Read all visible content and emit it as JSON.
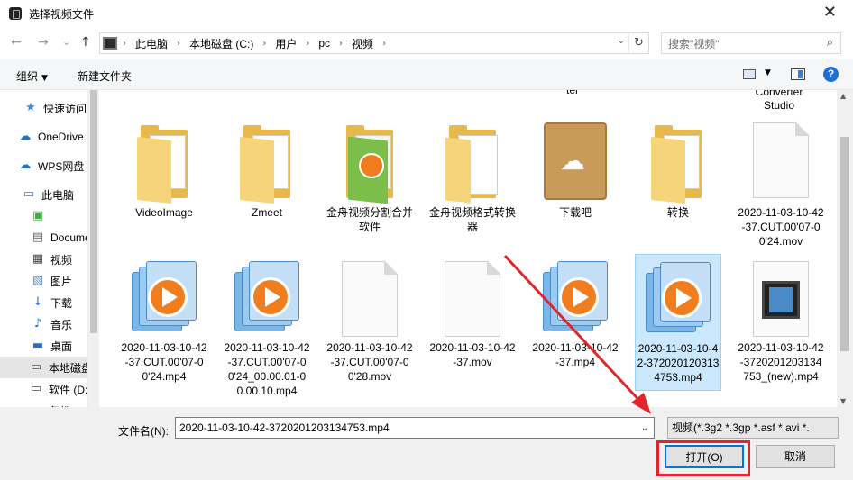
{
  "window": {
    "title": "选择视频文件",
    "close_glyph": "✕"
  },
  "nav": {
    "back_glyph": "←",
    "forward_glyph": "→",
    "recent_glyph": "⌄",
    "up_glyph": "↑",
    "breadcrumb": [
      "此电脑",
      "本地磁盘 (C:)",
      "用户",
      "pc",
      "视频"
    ],
    "breadcrumb_sep": "›",
    "dropdown_glyph": "⌄",
    "refresh_glyph": "↻",
    "search_placeholder": "搜索\"视频\"",
    "search_glyph": "⌕"
  },
  "toolbar": {
    "organize_label": "组织",
    "organize_caret": "▼",
    "new_folder_label": "新建文件夹",
    "view_caret": "▼",
    "help_label": "?"
  },
  "sidebar": {
    "items": [
      {
        "label": "快速访问",
        "icon": "star-icon",
        "glyph": "★",
        "color": "#3c88d8"
      },
      {
        "label": "OneDrive",
        "icon": "cloud-icon",
        "glyph": "☁",
        "color": "#1e73c8"
      },
      {
        "label": "WPS网盘",
        "icon": "cloud-icon",
        "glyph": "☁",
        "color": "#1e73c8"
      },
      {
        "label": "此电脑",
        "icon": "computer-icon",
        "glyph": "▭",
        "color": "#3a7bd5"
      },
      {
        "label": "",
        "icon": "app-icon",
        "glyph": "▣",
        "color": "#3eb03e"
      },
      {
        "label": "Documents",
        "icon": "document-icon",
        "glyph": "▤",
        "color": "#666666"
      },
      {
        "label": "视频",
        "icon": "film-icon",
        "glyph": "▦",
        "color": "#444444"
      },
      {
        "label": "图片",
        "icon": "picture-icon",
        "glyph": "▧",
        "color": "#5b86c6"
      },
      {
        "label": "下载",
        "icon": "download-icon",
        "glyph": "↓",
        "color": "#1e6fd9"
      },
      {
        "label": "音乐",
        "icon": "music-icon",
        "glyph": "♪",
        "color": "#1e6fd9"
      },
      {
        "label": "桌面",
        "icon": "desktop-icon",
        "glyph": "▬",
        "color": "#1e6fd9"
      },
      {
        "label": "本地磁盘 (C:)",
        "icon": "drive-icon",
        "glyph": "▭",
        "color": "#555555",
        "selected": true
      },
      {
        "label": "软件 (D:)",
        "icon": "drive-icon",
        "glyph": "▭",
        "color": "#555555"
      },
      {
        "label": "备份",
        "icon": "drive-icon",
        "glyph": "▭",
        "color": "#555555"
      }
    ]
  },
  "content": {
    "top_fragments": [
      "ter",
      "Converter",
      "Studio"
    ],
    "row1": [
      {
        "label": "VideoImage",
        "kind": "folder"
      },
      {
        "label": "Zmeet",
        "kind": "folder"
      },
      {
        "label": "金舟视频分割合并软件",
        "kind": "folder-media"
      },
      {
        "label": "金舟视频格式转换器",
        "kind": "folder-white"
      },
      {
        "label": "下载吧",
        "kind": "baidu"
      },
      {
        "label": "转换",
        "kind": "folder-plain"
      },
      {
        "label": "2020-11-03-10-42-37.CUT.00'07-00'24.mov",
        "kind": "doc"
      }
    ],
    "row2": [
      {
        "label": "2020-11-03-10-42-37.CUT.00'07-00'24.mp4",
        "kind": "wmp"
      },
      {
        "label": "2020-11-03-10-42-37.CUT.00'07-00'24_00.00.01-00.00.10.mp4",
        "kind": "wmp"
      },
      {
        "label": "2020-11-03-10-42-37.CUT.00'07-00'28.mov",
        "kind": "doc"
      },
      {
        "label": "2020-11-03-10-42-37.mov",
        "kind": "doc"
      },
      {
        "label": "2020-11-03-10-42-37.mp4",
        "kind": "wmp"
      },
      {
        "label": "2020-11-03-10-42-3720201203134753.mp4",
        "kind": "wmp",
        "selected": true
      },
      {
        "label": "2020-11-03-10-42-3720201203134753_(new).mp4",
        "kind": "vfile"
      }
    ]
  },
  "bottom": {
    "filename_label": "文件名(N):",
    "filename_value": "2020-11-03-10-42-3720201203134753.mp4",
    "filename_drop": "⌄",
    "filetype_value": "视频(*.3g2 *.3gp *.asf *.avi *.",
    "open_label": "打开(O)",
    "cancel_label": "取消"
  },
  "colors": {
    "accent": "#0078d7",
    "highlight_red": "#e0262c",
    "selection_bg": "#cce8ff"
  }
}
